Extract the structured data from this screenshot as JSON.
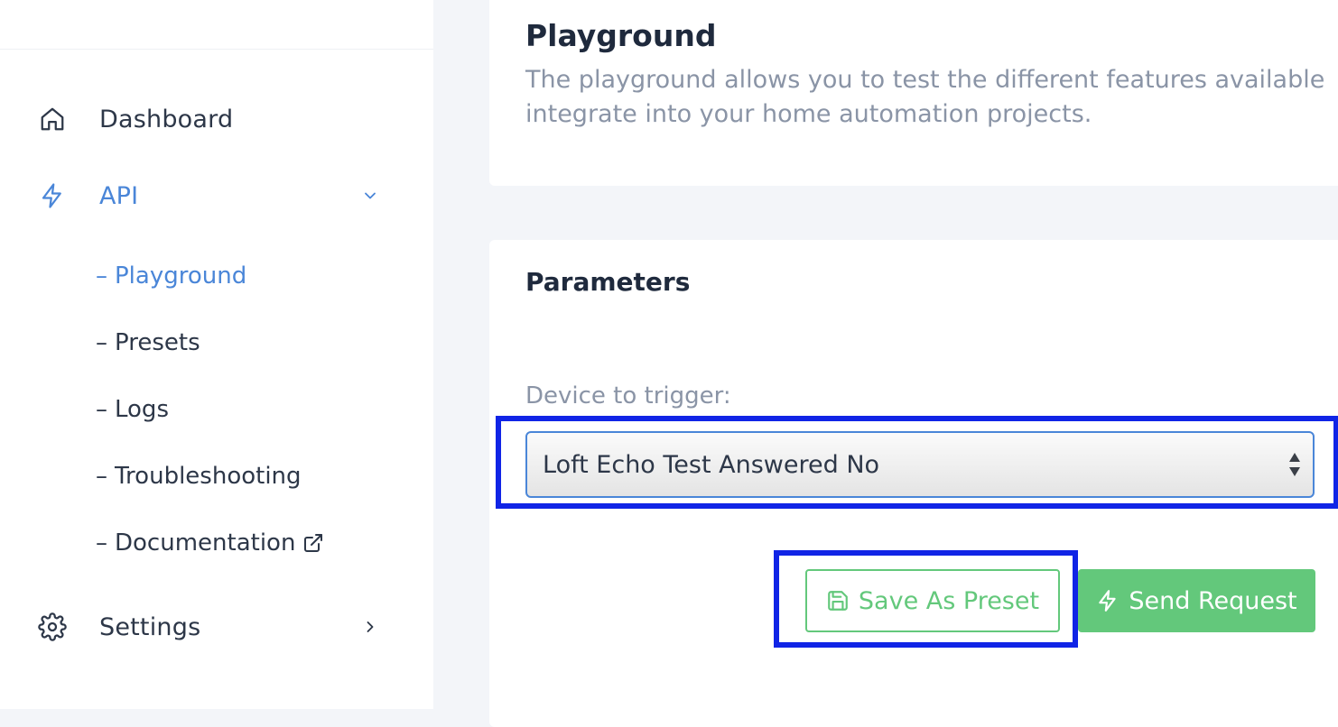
{
  "colors": {
    "accent": "#4a86d8",
    "success": "#63c87b",
    "highlight": "#1024e6",
    "text": "#2d3748",
    "muted": "#8a94a6"
  },
  "sidebar": {
    "items": [
      {
        "label": "Dashboard",
        "icon": "home-icon"
      },
      {
        "label": "API",
        "icon": "bolt-icon",
        "expanded": true
      },
      {
        "label": "Settings",
        "icon": "gear-icon"
      }
    ],
    "subitems": [
      {
        "dash": "–",
        "label": "Playground",
        "active": true
      },
      {
        "dash": "–",
        "label": "Presets"
      },
      {
        "dash": "–",
        "label": "Logs"
      },
      {
        "dash": "–",
        "label": "Troubleshooting"
      },
      {
        "dash": "–",
        "label": "Documentation",
        "icon": "external-link-icon"
      }
    ]
  },
  "main": {
    "title": "Playground",
    "description_line1": "The playground allows you to test the different features available",
    "description_line2": "integrate into your home automation projects.",
    "parameters": {
      "title": "Parameters",
      "device_label": "Device to trigger:",
      "device_value": "Loft Echo Test Answered No"
    },
    "actions": {
      "save_label": "Save As Preset",
      "send_label": "Send Request"
    }
  }
}
